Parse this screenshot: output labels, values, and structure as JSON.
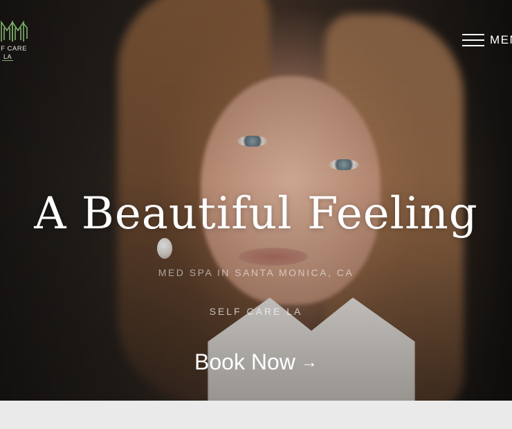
{
  "brand": {
    "logo_line1": "F CARE",
    "logo_line2": "LA"
  },
  "nav": {
    "menu_label": "MENU"
  },
  "hero": {
    "headline": "A Beautiful Feeling",
    "subline": "MED SPA IN SANTA MONICA, CA",
    "tagline": "SELF CARE LA",
    "cta_label": "Book Now",
    "cta_arrow": "→"
  },
  "colors": {
    "logo_green": "#7fb26d",
    "text_white": "#ffffff",
    "page_bg": "#eaeaea"
  }
}
